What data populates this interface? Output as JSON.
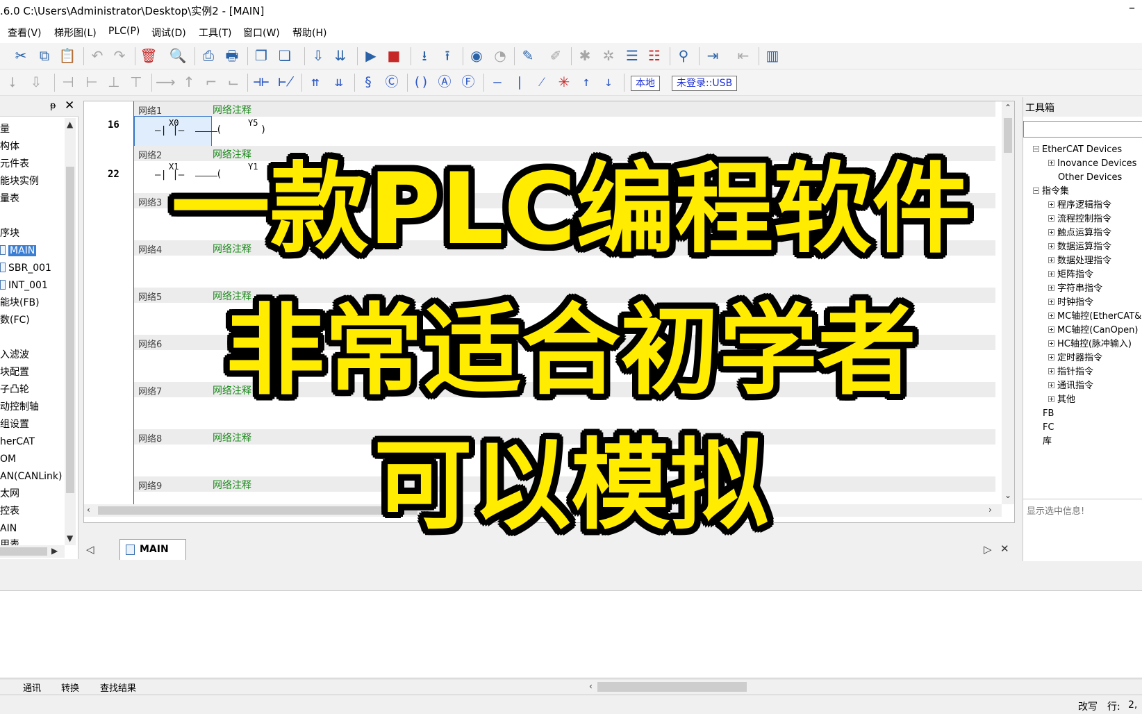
{
  "window": {
    "title": ".6.0  C:\\Users\\Administrator\\Desktop\\实例2 - [MAIN]",
    "close_glyph": "–"
  },
  "menu": [
    "查看(V)",
    "梯形图(L)",
    "PLC(P)",
    "调试(D)",
    "工具(T)",
    "窗口(W)",
    "帮助(H)"
  ],
  "toolbar2_tags": {
    "local": "本地",
    "login": "未登录::USB"
  },
  "left_panel": {
    "pin": "ᵽ",
    "close": "✕",
    "items": [
      "量",
      "构体",
      "元件表",
      "能块实例",
      "量表",
      "",
      "序块",
      "MAIN",
      "SBR_001",
      "INT_001",
      "能块(FB)",
      "数(FC)",
      "",
      "入滤波",
      "块配置",
      "子凸轮",
      "动控制轴",
      "组设置",
      "herCAT",
      "OM",
      "AN(CANLink)",
      "太网",
      "控表",
      "AIN",
      "用表"
    ]
  },
  "editor": {
    "networks": [
      {
        "label": "网络1",
        "comment": "网络注释"
      },
      {
        "label": "网络2",
        "comment": "网络注释"
      },
      {
        "label": "网络3",
        "comment": "网络注释"
      },
      {
        "label": "网络4",
        "comment": "网络注释"
      },
      {
        "label": "网络5",
        "comment": "网络注释"
      },
      {
        "label": "网络6",
        "comment": ""
      },
      {
        "label": "网络7",
        "comment": "网络注释"
      },
      {
        "label": "网络8",
        "comment": "网络注释"
      },
      {
        "label": "网络9",
        "comment": "网络注释"
      }
    ],
    "line_numbers": [
      "16",
      "22"
    ],
    "rung1": {
      "contact": "X0",
      "coil": "Y5",
      "contact_glyph": "—| |—",
      "coil_open": "(",
      "coil_close": ")"
    },
    "rung2": {
      "contact": "X1",
      "coil": "Y1",
      "contact_glyph": "—| |—",
      "coil_open": "("
    }
  },
  "tabs": {
    "main": "MAIN",
    "prev": "◁",
    "next": "▷",
    "close": "✕"
  },
  "right_panel": {
    "title": "工具箱",
    "tree": [
      {
        "label": "EtherCAT Devices",
        "level": 0,
        "state": "minus"
      },
      {
        "label": "Inovance Devices",
        "level": 1,
        "state": "plus"
      },
      {
        "label": "Other Devices",
        "level": 1,
        "state": ""
      },
      {
        "label": "指令集",
        "level": 0,
        "state": "minus"
      },
      {
        "label": "程序逻辑指令",
        "level": 1,
        "state": "plus"
      },
      {
        "label": "流程控制指令",
        "level": 1,
        "state": "plus"
      },
      {
        "label": "触点运算指令",
        "level": 1,
        "state": "plus"
      },
      {
        "label": "数据运算指令",
        "level": 1,
        "state": "plus"
      },
      {
        "label": "数据处理指令",
        "level": 1,
        "state": "plus"
      },
      {
        "label": "矩阵指令",
        "level": 1,
        "state": "plus"
      },
      {
        "label": "字符串指令",
        "level": 1,
        "state": "plus"
      },
      {
        "label": "时钟指令",
        "level": 1,
        "state": "plus"
      },
      {
        "label": "MC轴控(EtherCAT&",
        "level": 1,
        "state": "plus"
      },
      {
        "label": "MC轴控(CanOpen)",
        "level": 1,
        "state": "plus"
      },
      {
        "label": "HC轴控(脉冲输入)",
        "level": 1,
        "state": "plus"
      },
      {
        "label": "定时器指令",
        "level": 1,
        "state": "plus"
      },
      {
        "label": "指针指令",
        "level": 1,
        "state": "plus"
      },
      {
        "label": "通讯指令",
        "level": 1,
        "state": "plus"
      },
      {
        "label": "其他",
        "level": 1,
        "state": "plus"
      },
      {
        "label": "FB",
        "level": 0,
        "state": ""
      },
      {
        "label": "FC",
        "level": 0,
        "state": ""
      },
      {
        "label": "库",
        "level": 0,
        "state": ""
      }
    ],
    "info": "显示选中信息!"
  },
  "bottom_tabs": [
    "通讯",
    "转换",
    "查找结果"
  ],
  "status": {
    "mode": "改写",
    "row_label": "行:",
    "row_value": "2,"
  },
  "overlay": {
    "line1": "一款PLC编程软件",
    "line2": "非常适合初学者",
    "line3": "可以模拟"
  },
  "colors": {
    "overlay_text": "#ffec00",
    "comment_green": "#1e8a1e",
    "selection": "#3b7fd5",
    "ladder_blue": "#2b57c4"
  }
}
